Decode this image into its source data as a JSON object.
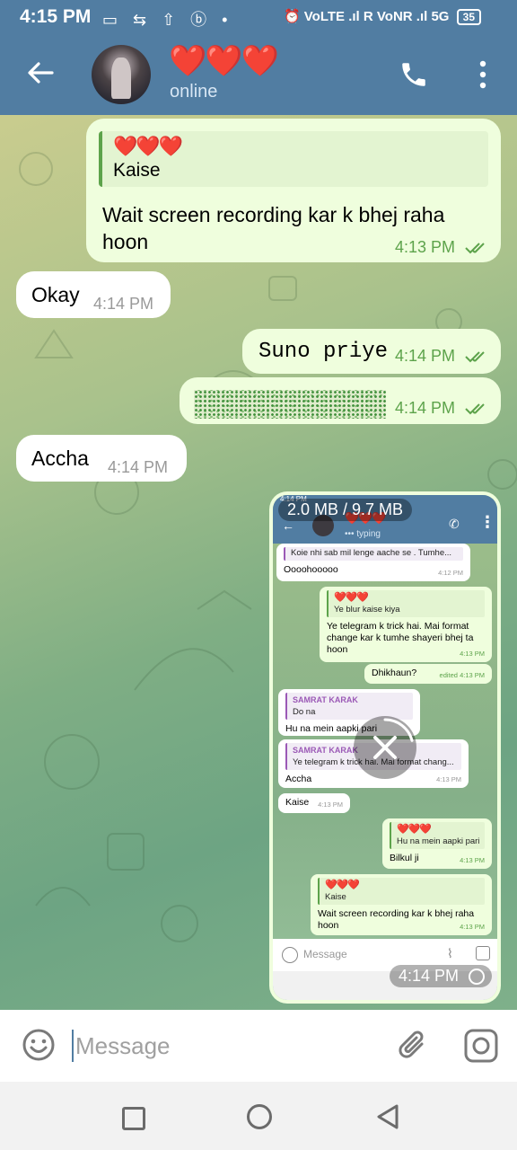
{
  "status_bar": {
    "time": "4:15 PM",
    "left_icons": "▭ ⇆ ⇧ ⓑ •",
    "right_text": "⏰ VoLTE .ıl R VoNR .ıl 5G",
    "battery": "35"
  },
  "header": {
    "contact_name": "❤️❤️❤️",
    "status": "online"
  },
  "messages": [
    {
      "direction": "out",
      "reply_name": "❤️❤️❤️",
      "reply_text": "Kaise",
      "text": "Wait screen recording kar k bhej raha hoon",
      "time": "4:13 PM",
      "read": true
    },
    {
      "direction": "in",
      "text": "Okay",
      "time": "4:14 PM"
    },
    {
      "direction": "out",
      "text": "Suno priye",
      "time": "4:14 PM",
      "read": true
    },
    {
      "direction": "out",
      "text": "",
      "blurred": true,
      "time": "4:14 PM",
      "read": true
    },
    {
      "direction": "in",
      "text": "Accha",
      "time": "4:14 PM"
    }
  ],
  "video": {
    "progress": "2.0 MB / 9.7 MB",
    "time": "4:14 PM",
    "download_progress_fraction": 0.21,
    "inner": {
      "status": "4:14 PM",
      "name": "❤️❤️❤️",
      "typing": "••• typing",
      "messages": [
        {
          "dir": "in",
          "quote_name": "SAMRAT KARAK",
          "quote_text": "Koie nhi sab mil lenge aache se  . Tumhe...",
          "text": "Oooohooooo",
          "time": "4:12 PM"
        },
        {
          "dir": "out",
          "quote_name": "❤️❤️❤️",
          "quote_text": "Ye blur kaise kiya",
          "text": "Ye telegram k trick hai. Mai format change kar k tumhe shayeri bhej ta hoon",
          "time": "4:13 PM"
        },
        {
          "dir": "out",
          "text": "Dhikhaun?",
          "time": "edited 4:13 PM"
        },
        {
          "dir": "in",
          "quote_name": "SAMRAT KARAK",
          "quote_text": "Do na",
          "text": "Hu na mein aapki pari",
          "time": ""
        },
        {
          "dir": "in",
          "quote_name": "SAMRAT KARAK",
          "quote_text": "Ye telegram k trick hai. Mai format chang...",
          "text": "Accha",
          "time": "4:13 PM"
        },
        {
          "dir": "in",
          "text": "Kaise",
          "time": "4:13 PM"
        },
        {
          "dir": "out",
          "quote_name": "❤️❤️❤️",
          "quote_text": "Hu na mein aapki pari",
          "text": "Bilkul ji",
          "time": "4:13 PM"
        },
        {
          "dir": "out",
          "quote_name": "❤️❤️❤️",
          "quote_text": "Kaise",
          "text": "Wait screen recording kar k bhej raha hoon",
          "time": "4:13 PM"
        }
      ],
      "input_placeholder": "Message"
    }
  },
  "input": {
    "placeholder": "Message",
    "value": ""
  },
  "colors": {
    "header": "#517da2",
    "outgoing_bubble": "#effedd",
    "incoming_bubble": "#ffffff",
    "accent_green": "#5da34b"
  },
  "icons": [
    "back-arrow-icon",
    "phone-icon",
    "more-vert-icon",
    "double-check-icon",
    "emoji-icon",
    "attach-icon",
    "camera-icon",
    "close-icon"
  ]
}
